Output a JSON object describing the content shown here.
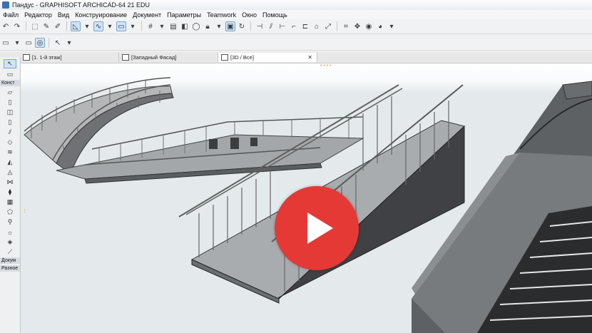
{
  "window": {
    "title": "Пандус - GRAPHISOFT ARCHICAD-64 21 EDU"
  },
  "menu": [
    "Файл",
    "Редактор",
    "Вид",
    "Конструирование",
    "Документ",
    "Параметры",
    "Teamwork",
    "Окно",
    "Помощь"
  ],
  "tabs": [
    {
      "label": "[1. 1-й этаж]"
    },
    {
      "label": "[Западный Фасад]"
    },
    {
      "label": "[3D / Все]"
    }
  ],
  "toolbox": {
    "sections": [
      "Конст",
      "Докум",
      "Разное"
    ]
  },
  "colors": {
    "play_button": "#e53935",
    "viewport_bg": "#e4eaec",
    "accent": "#cfe3f8"
  },
  "video": {
    "play_icon": "play-icon"
  }
}
